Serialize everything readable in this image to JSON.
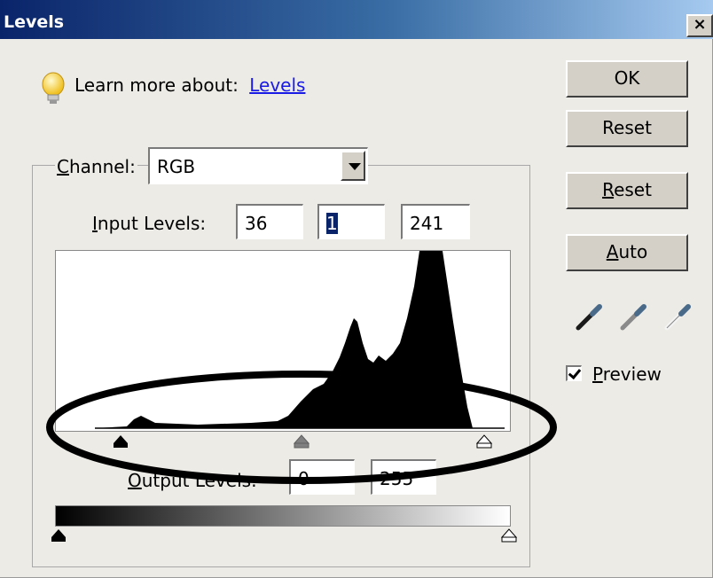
{
  "window": {
    "title": "Levels",
    "close_symbol": "×"
  },
  "learn": {
    "prefix": "Learn more about:",
    "link": "Levels"
  },
  "channel": {
    "label": "Channel:",
    "value": "RGB"
  },
  "input_levels": {
    "label": "Input Levels:",
    "shadow": "36",
    "midtone": "1",
    "highlight": "241"
  },
  "output_levels": {
    "label": "Output Levels:",
    "shadow": "0",
    "highlight": "255"
  },
  "buttons": {
    "ok": "OK",
    "reset": "Reset",
    "reset2": "Reset",
    "auto": "Auto"
  },
  "preview": {
    "label": "Preview",
    "checked": true
  },
  "icons": {
    "info": "lightbulb-icon",
    "eyedroppers": [
      "black-point-eyedropper-icon",
      "gray-point-eyedropper-icon",
      "white-point-eyedropper-icon"
    ]
  },
  "colors": {
    "title_start": "#0a246a",
    "title_end": "#a6caf0",
    "link": "#1a1ae6",
    "dialog_bg": "#ecebe6"
  }
}
